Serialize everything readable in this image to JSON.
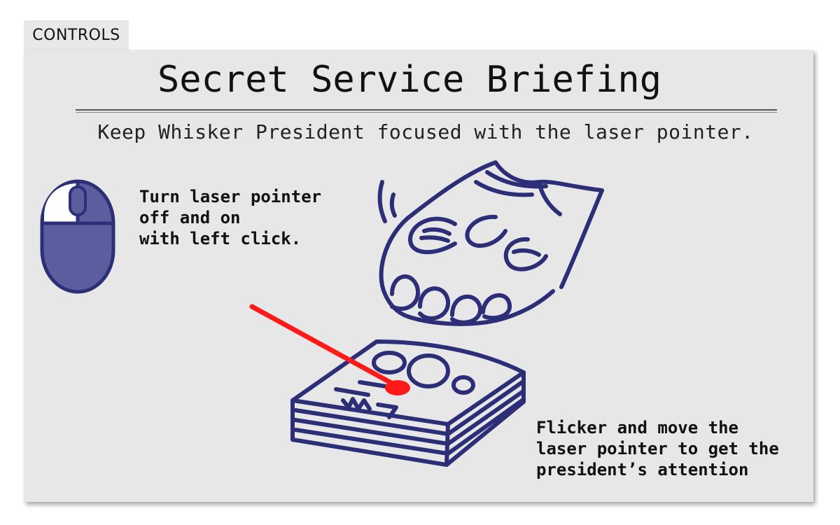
{
  "tab": {
    "label": "CONTROLS"
  },
  "briefing": {
    "title": "Secret Service Briefing",
    "subtitle": "Keep Whisker President focused with the laser pointer."
  },
  "instructions": {
    "click_text": "Turn laser pointer\noff and on\nwith left click.",
    "move_text": "Flicker and move the\nlaser pointer to get the\npresident’s attention"
  },
  "icons": {
    "mouse": "mouse-left-click-icon",
    "paw": "cat-paw-icon",
    "laser": "laser-beam-icon",
    "box": "document-box-icon"
  },
  "colors": {
    "ink": "#2c2f78",
    "mouse_fill": "#5a5e9e",
    "mouse_highlight": "#ffffff",
    "laser": "#ff1a1a",
    "panel": "#e7e7e7"
  }
}
